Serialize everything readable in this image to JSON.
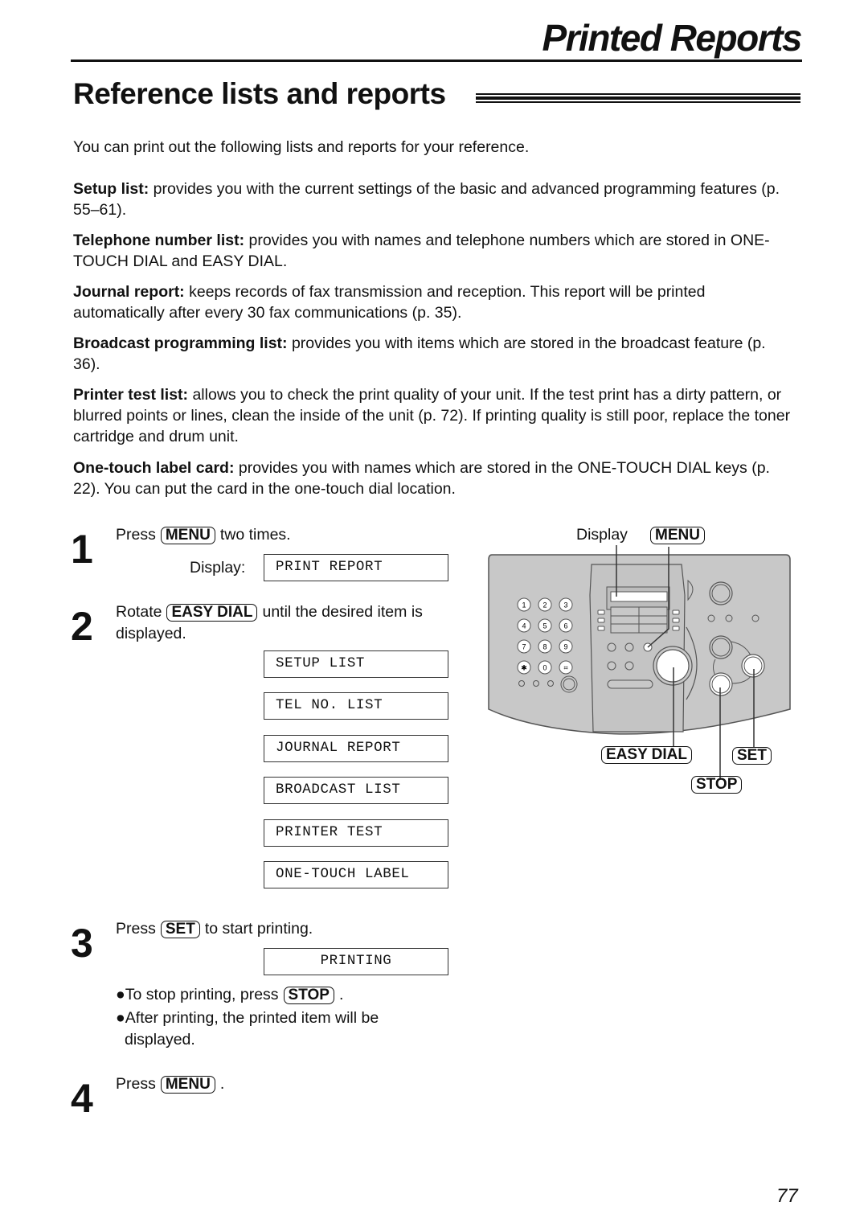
{
  "header": {
    "chapter_title": "Printed Reports",
    "section_title": "Reference lists and reports"
  },
  "intro": "You can print out the following lists and reports for your reference.",
  "definitions": [
    {
      "term": "Setup list:",
      "text": " provides you with the current settings of the basic and advanced programming features (p. 55–61)."
    },
    {
      "term": "Telephone number list:",
      "text": " provides you with names and telephone numbers which are stored in ONE-TOUCH DIAL and EASY DIAL."
    },
    {
      "term": "Journal report:",
      "text": " keeps records of fax transmission and reception. This report will be printed automatically after every 30 fax communications (p. 35)."
    },
    {
      "term": "Broadcast programming list:",
      "text": " provides you with items which are stored in the broadcast feature (p. 36)."
    },
    {
      "term": "Printer test list:",
      "text": " allows you to check the print quality of your unit. If the test print has a dirty pattern, or blurred points or lines, clean the inside of the unit (p. 72). If printing quality is still poor, replace the toner cartridge and drum unit."
    },
    {
      "term": "One-touch label card:",
      "text": " provides you with names which are stored in the ONE-TOUCH DIAL keys (p. 22). You can put the card in the one-touch dial location."
    }
  ],
  "steps": {
    "step1": {
      "number": "1",
      "before": "Press",
      "key": "MENU",
      "after": "two times.",
      "display_label": "Display:",
      "display": "PRINT REPORT"
    },
    "step2": {
      "number": "2",
      "before": "Rotate",
      "key": "EASY DIAL",
      "after": "until the desired item is",
      "line2": "displayed.",
      "displays": [
        "SETUP LIST",
        "TEL NO. LIST",
        "JOURNAL REPORT",
        "BROADCAST LIST",
        "PRINTER TEST",
        "ONE-TOUCH LABEL"
      ]
    },
    "step3": {
      "number": "3",
      "before": "Press",
      "key": "SET",
      "after": "to start printing.",
      "display": "PRINTING",
      "bullet1_before": "●To stop printing, press",
      "bullet1_key": "STOP",
      "bullet1_after": ".",
      "bullet2_line1": "●After printing, the printed item will be",
      "bullet2_line2": "displayed."
    },
    "step4": {
      "number": "4",
      "before": "Press",
      "key": "MENU",
      "after": "."
    }
  },
  "diagram": {
    "display_label": "Display",
    "keys": {
      "menu": "MENU",
      "easy_dial": "EASY DIAL",
      "set": "SET",
      "stop": "STOP"
    },
    "keypad": [
      "1",
      "2",
      "3",
      "4",
      "5",
      "6",
      "7",
      "8",
      "9",
      "*",
      "0",
      "#"
    ],
    "colors": {
      "panel": "#c8c8c8",
      "panel_stroke": "#555555",
      "button": "#ffffff"
    }
  },
  "footer": {
    "page_number": "77"
  }
}
